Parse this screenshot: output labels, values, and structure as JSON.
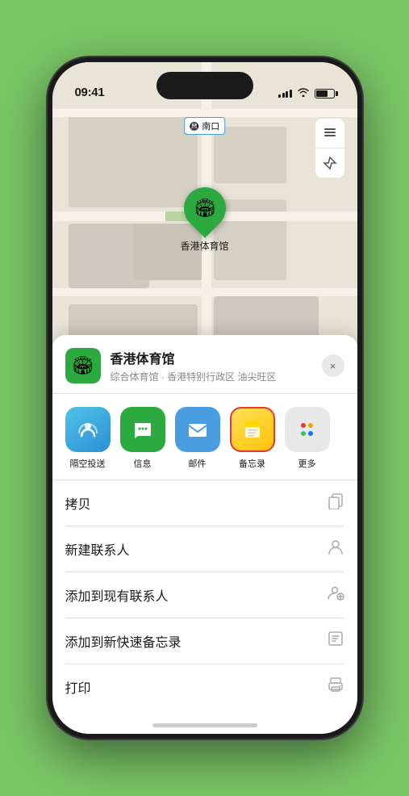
{
  "status_bar": {
    "time": "09:41",
    "location_arrow": "▶"
  },
  "map": {
    "station_label": "南口",
    "marker_label": "香港体育馆",
    "marker_emoji": "🏟"
  },
  "venue": {
    "name": "香港体育馆",
    "address": "综合体育馆 · 香港特别行政区 油尖旺区",
    "icon_emoji": "🏟"
  },
  "share_items": [
    {
      "id": "airdrop",
      "label": "隔空投送",
      "emoji": "📡",
      "bg_class": "airdrop-bg"
    },
    {
      "id": "messages",
      "label": "信息",
      "emoji": "💬",
      "bg_class": "messages-bg"
    },
    {
      "id": "mail",
      "label": "邮件",
      "emoji": "✉️",
      "bg_class": "mail-bg"
    },
    {
      "id": "notes",
      "label": "备忘录",
      "emoji": "📝",
      "bg_class": "notes-bg"
    }
  ],
  "actions": [
    {
      "id": "copy",
      "label": "拷贝",
      "icon": "⎘"
    },
    {
      "id": "new-contact",
      "label": "新建联系人",
      "icon": "👤"
    },
    {
      "id": "add-contact",
      "label": "添加到现有联系人",
      "icon": "👤"
    },
    {
      "id": "add-notes",
      "label": "添加到新快速备忘录",
      "icon": "⊡"
    },
    {
      "id": "print",
      "label": "打印",
      "icon": "🖨"
    }
  ],
  "close_label": "×"
}
